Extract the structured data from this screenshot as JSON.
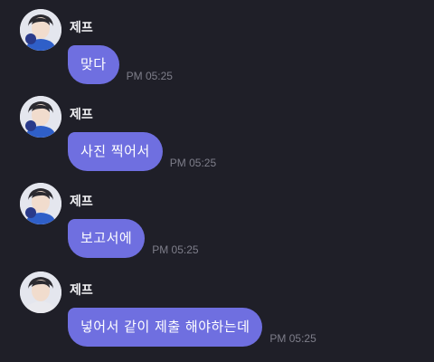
{
  "chat": {
    "messages": [
      {
        "sender": "제프",
        "text": "맞다",
        "time": "PM 05:25"
      },
      {
        "sender": "제프",
        "text": "사진 찍어서",
        "time": "PM 05:25"
      },
      {
        "sender": "제프",
        "text": "보고서에",
        "time": "PM 05:25"
      },
      {
        "sender": "제프",
        "text": "넣어서 같이 제출 해야하는데",
        "time": "PM 05:25"
      }
    ]
  },
  "colors": {
    "background": "#1f1f28",
    "bubble": "#6f6fe0",
    "bubble_text": "#ffffff",
    "sender_text": "#f2f2f5",
    "time_text": "#7e7e8a"
  }
}
